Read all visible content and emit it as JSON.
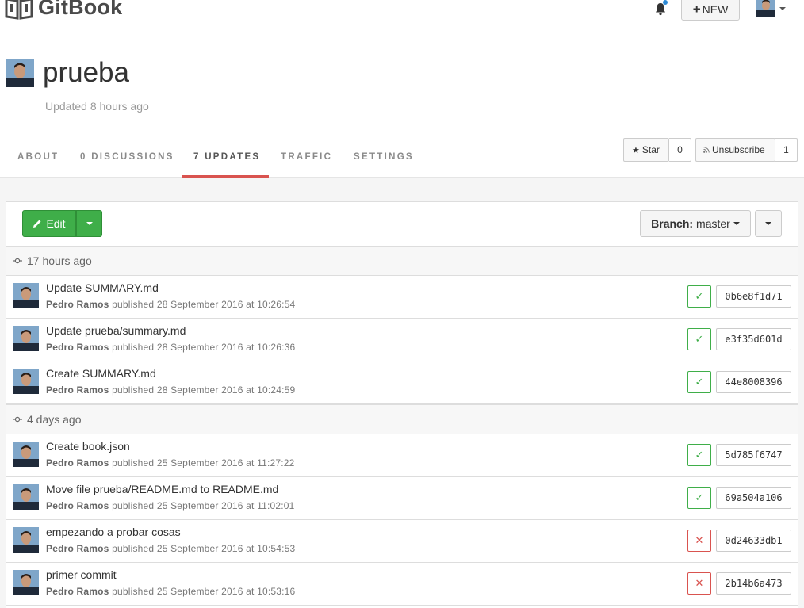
{
  "app": {
    "name": "GitBook"
  },
  "topbar": {
    "new_label": "NEW",
    "new_plus": "+"
  },
  "book": {
    "title": "prueba",
    "updated": "Updated 8 hours ago"
  },
  "tabs": [
    {
      "label": "ABOUT"
    },
    {
      "label": "0 DISCUSSIONS"
    },
    {
      "label": "7 UPDATES"
    },
    {
      "label": "TRAFFIC"
    },
    {
      "label": "SETTINGS"
    }
  ],
  "social": {
    "star_label": "Star",
    "star_count": "0",
    "unsubscribe_label": "Unsubscribe",
    "subscriber_count": "1"
  },
  "toolbar": {
    "edit_label": "Edit",
    "branch_prefix": "Branch:",
    "branch_name": "master"
  },
  "groups": [
    {
      "label": "17 hours ago",
      "commits": [
        {
          "message": "Update SUMMARY.md",
          "author": "Pedro Ramos",
          "published": "published 28 September 2016 at 10:26:54",
          "status": "ok",
          "sha": "0b6e8f1d71"
        },
        {
          "message": "Update prueba/summary.md",
          "author": "Pedro Ramos",
          "published": "published 28 September 2016 at 10:26:36",
          "status": "ok",
          "sha": "e3f35d601d"
        },
        {
          "message": "Create SUMMARY.md",
          "author": "Pedro Ramos",
          "published": "published 28 September 2016 at 10:24:59",
          "status": "ok",
          "sha": "44e8008396"
        }
      ]
    },
    {
      "label": "4 days ago",
      "commits": [
        {
          "message": "Create book.json",
          "author": "Pedro Ramos",
          "published": "published 25 September 2016 at 11:27:22",
          "status": "ok",
          "sha": "5d785f6747"
        },
        {
          "message": "Move file prueba/README.md to README.md",
          "author": "Pedro Ramos",
          "published": "published 25 September 2016 at 11:02:01",
          "status": "ok",
          "sha": "69a504a106"
        },
        {
          "message": "empezando a probar cosas",
          "author": "Pedro Ramos",
          "published": "published 25 September 2016 at 10:54:53",
          "status": "fail",
          "sha": "0d24633db1"
        },
        {
          "message": "primer commit",
          "author": "Pedro Ramos",
          "published": "published 25 September 2016 at 10:53:16",
          "status": "fail",
          "sha": "2b14b6a473"
        }
      ]
    }
  ],
  "colors": {
    "accent_green": "#3fae49",
    "error_red": "#d9534f",
    "active_tab": "#d9534f",
    "notification_blue": "#2d8ad6"
  },
  "icons": {
    "logo": "gitbook-book-icon",
    "bell": "bell-icon",
    "star": "star-icon",
    "rss": "rss-icon",
    "pencil": "pencil-icon",
    "commit": "commit-icon",
    "ok": "check-icon",
    "fail": "cross-icon"
  }
}
